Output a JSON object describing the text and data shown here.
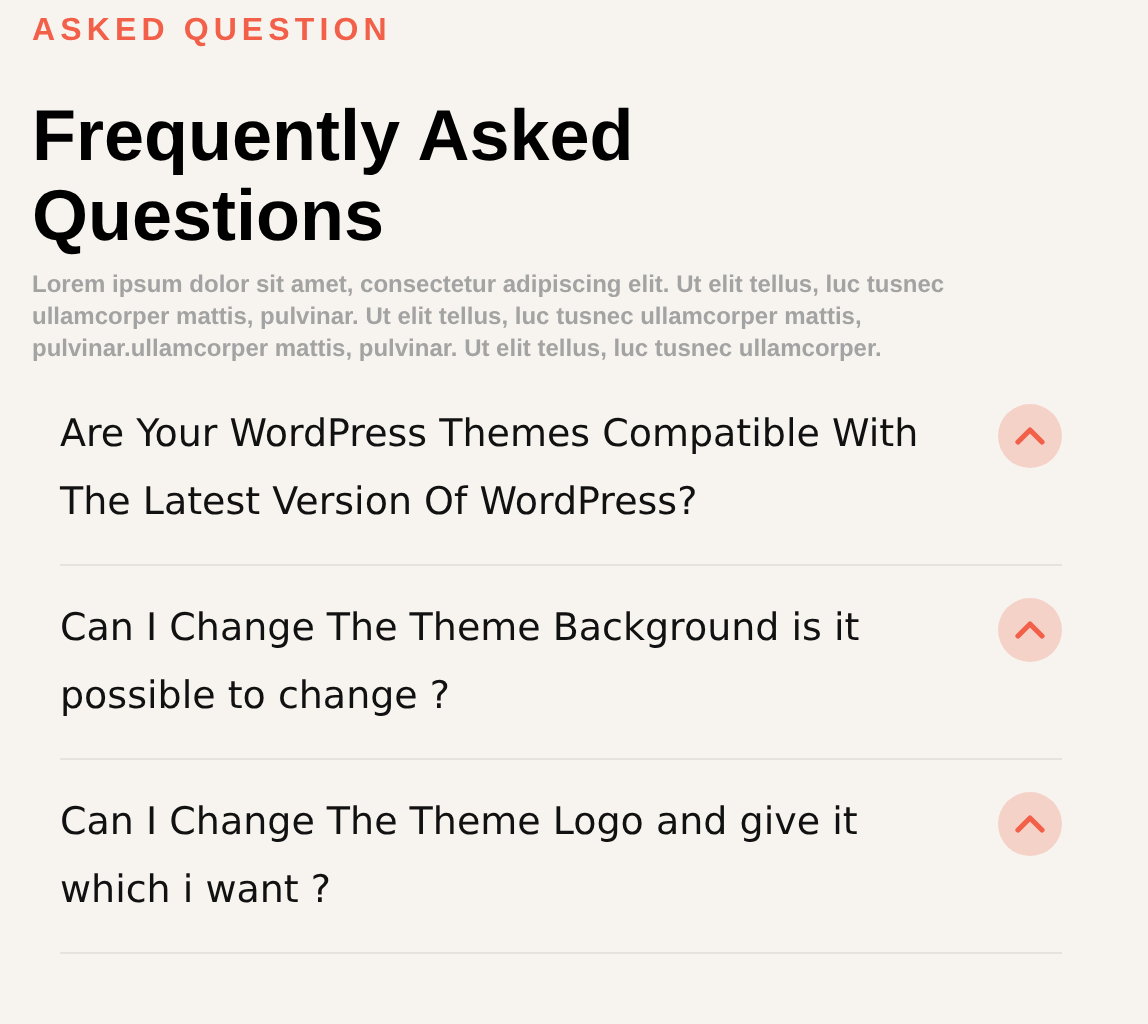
{
  "eyebrow": "ASKED QUESTION",
  "title": "Frequently Asked Questions",
  "intro": "Lorem ipsum dolor sit amet, consectetur adipiscing elit. Ut elit tellus, luc tusnec ullamcorper mattis, pulvinar. Ut elit tellus, luc tusnec ullamcorper mattis, pulvinar.ullamcorper mattis, pulvinar. Ut elit tellus, luc tusnec ullamcorper.",
  "faq": [
    {
      "question": "Are Your WordPress Themes Compatible With The Latest Version Of WordPress?"
    },
    {
      "question": "Can I Change The Theme Background is it possible to change ?"
    },
    {
      "question": "Can I Change The Theme Logo and give it which i want ?"
    }
  ]
}
